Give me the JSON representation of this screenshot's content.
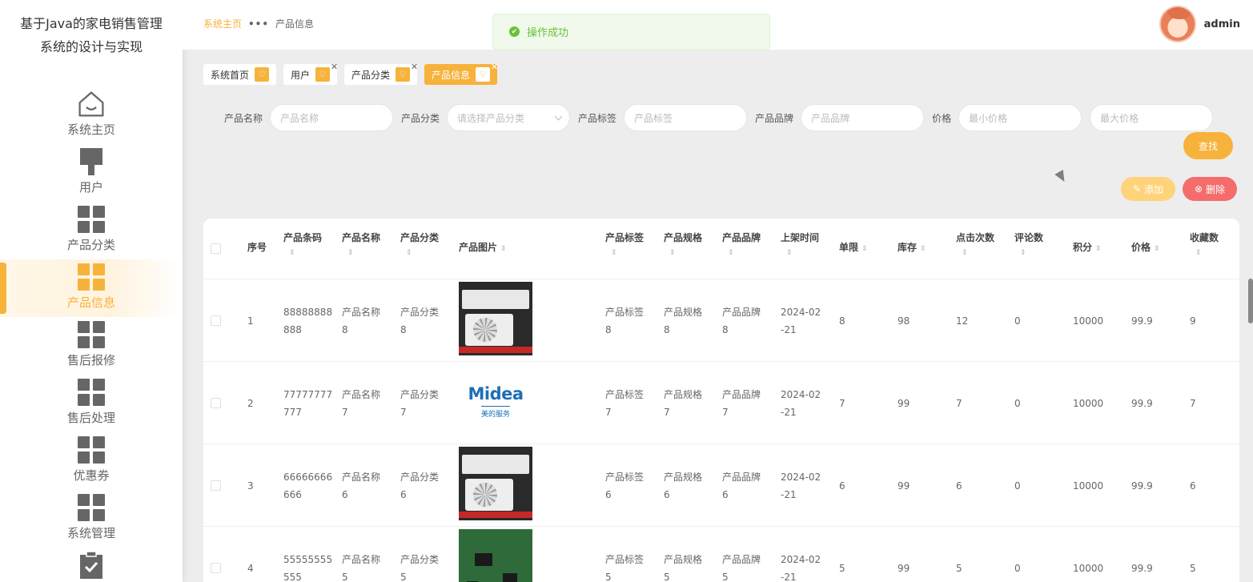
{
  "app": {
    "title": "基于Java的家电销售管理系统的设计与实现"
  },
  "sidebar": {
    "items": [
      {
        "label": "系统主页",
        "icon": "home-icon"
      },
      {
        "label": "用户",
        "icon": "brush-icon"
      },
      {
        "label": "产品分类",
        "icon": "grid-icon"
      },
      {
        "label": "产品信息",
        "icon": "grid-icon",
        "active": true
      },
      {
        "label": "售后报修",
        "icon": "grid-icon"
      },
      {
        "label": "售后处理",
        "icon": "grid-icon"
      },
      {
        "label": "优惠券",
        "icon": "grid-icon"
      },
      {
        "label": "系统管理",
        "icon": "grid-icon"
      }
    ]
  },
  "header": {
    "breadcrumb": {
      "home": "系统主页",
      "separator": "•••",
      "current": "产品信息"
    },
    "toast": "操作成功",
    "user": "admin"
  },
  "tags": [
    {
      "label": "系统首页",
      "closable": false
    },
    {
      "label": "用户",
      "closable": true
    },
    {
      "label": "产品分类",
      "closable": true
    },
    {
      "label": "产品信息",
      "closable": true,
      "active": true
    }
  ],
  "filters": {
    "name": {
      "label": "产品名称",
      "placeholder": "产品名称"
    },
    "category": {
      "label": "产品分类",
      "placeholder": "请选择产品分类"
    },
    "tag": {
      "label": "产品标签",
      "placeholder": "产品标签"
    },
    "brand": {
      "label": "产品品牌",
      "placeholder": "产品品牌"
    },
    "price": {
      "label": "价格",
      "min_placeholder": "最小价格",
      "max_placeholder": "最大价格"
    },
    "search_label": "查找"
  },
  "actions": {
    "add_label": "添加",
    "delete_label": "删除"
  },
  "table": {
    "columns": [
      "序号",
      "产品条码",
      "产品名称",
      "产品分类",
      "产品图片",
      "产品标签",
      "产品规格",
      "产品品牌",
      "上架时间",
      "单限",
      "库存",
      "点击次数",
      "评论数",
      "积分",
      "价格",
      "收藏数"
    ],
    "rows": [
      {
        "index": "1",
        "code": [
          "88888888",
          "888"
        ],
        "name": [
          "产品名称",
          "8"
        ],
        "category": [
          "产品分类",
          "8"
        ],
        "image": "ac",
        "tag": [
          "产品标签",
          "8"
        ],
        "spec": [
          "产品规格",
          "8"
        ],
        "brand": [
          "产品品牌",
          "8"
        ],
        "date": [
          "2024-02",
          "-21"
        ],
        "limit": "8",
        "stock": "98",
        "clicks": "12",
        "comments": "0",
        "points": "10000",
        "price": "99.9",
        "favorites": "9"
      },
      {
        "index": "2",
        "code": [
          "77777777",
          "777"
        ],
        "name": [
          "产品名称",
          "7"
        ],
        "category": [
          "产品分类",
          "7"
        ],
        "image": "midea",
        "tag": [
          "产品标签",
          "7"
        ],
        "spec": [
          "产品规格",
          "7"
        ],
        "brand": [
          "产品品牌",
          "7"
        ],
        "date": [
          "2024-02",
          "-21"
        ],
        "limit": "7",
        "stock": "99",
        "clicks": "7",
        "comments": "0",
        "points": "10000",
        "price": "99.9",
        "favorites": "7"
      },
      {
        "index": "3",
        "code": [
          "66666666",
          "666"
        ],
        "name": [
          "产品名称",
          "6"
        ],
        "category": [
          "产品分类",
          "6"
        ],
        "image": "ac",
        "tag": [
          "产品标签",
          "6"
        ],
        "spec": [
          "产品规格",
          "6"
        ],
        "brand": [
          "产品品牌",
          "6"
        ],
        "date": [
          "2024-02",
          "-21"
        ],
        "limit": "6",
        "stock": "99",
        "clicks": "6",
        "comments": "0",
        "points": "10000",
        "price": "99.9",
        "favorites": "6"
      },
      {
        "index": "4",
        "code": [
          "55555555",
          "555"
        ],
        "name": [
          "产品名称",
          "5"
        ],
        "category": [
          "产品分类",
          "5"
        ],
        "image": "pcb",
        "tag": [
          "产品标签",
          "5"
        ],
        "spec": [
          "产品规格",
          "5"
        ],
        "brand": [
          "产品品牌",
          "5"
        ],
        "date": [
          "2024-02",
          "-21"
        ],
        "limit": "5",
        "stock": "99",
        "clicks": "5",
        "comments": "0",
        "points": "10000",
        "price": "99.9",
        "favorites": "5"
      }
    ]
  },
  "midea_image": {
    "brand_text": "Midea",
    "sub_text": "美的服务"
  }
}
